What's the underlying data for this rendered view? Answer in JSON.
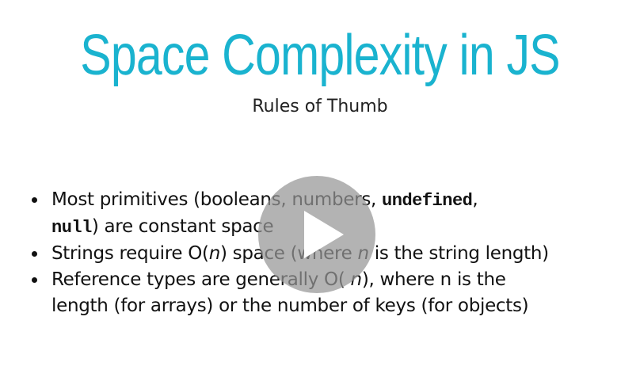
{
  "slide": {
    "title": "Space Complexity in JS",
    "subtitle": "Rules of Thumb",
    "colors": {
      "title": "#1ab3cf",
      "text": "#111111",
      "play_overlay": "#969696"
    },
    "bullets": [
      {
        "line1_pre": "Most primitives (booleans, numbers, ",
        "line1_code": "undefined",
        "line1_post": ",",
        "line2_code": "null",
        "line2_post": ") are constant space"
      },
      {
        "pre": "Strings require O(",
        "var": "n",
        "mid": ") space (where ",
        "var2": "n",
        "post": " is the string length)"
      },
      {
        "line1_pre": "Reference types are generally O( ",
        "var": "n",
        "line1_post": "), where n is the",
        "line2": "length (for arrays) or the number of keys (for objects)"
      }
    ]
  },
  "player": {
    "play_icon": "play-icon"
  }
}
